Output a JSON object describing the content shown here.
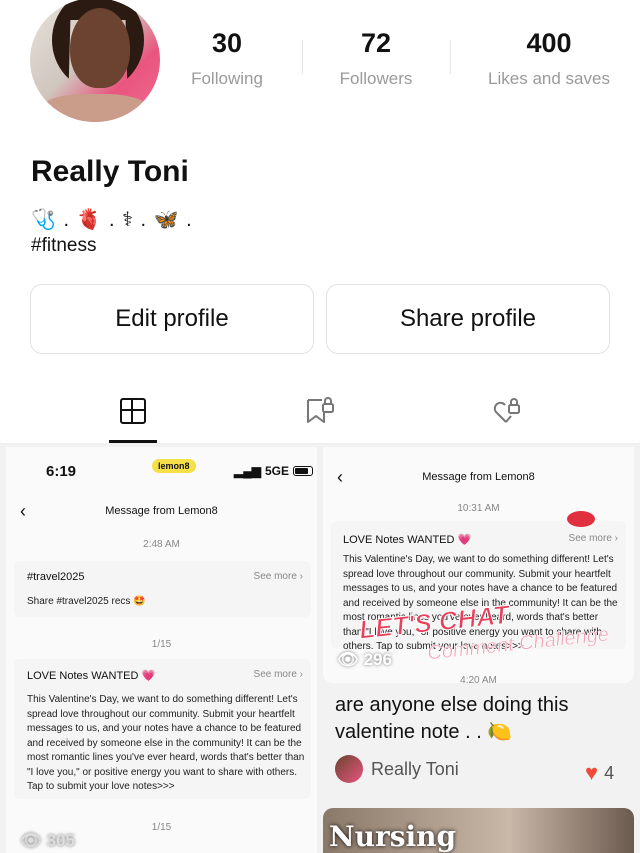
{
  "profile": {
    "name": "Really Toni",
    "bio_emojis": "🩺 . 🫀 . ⚕ . 🦋 .",
    "hashtag": "#fitness",
    "stats": [
      {
        "value": "30",
        "label": "Following"
      },
      {
        "value": "72",
        "label": "Followers"
      },
      {
        "value": "400",
        "label": "Likes and saves"
      }
    ],
    "edit_label": "Edit profile",
    "share_label": "Share profile"
  },
  "tabs": [
    "notes-grid-icon",
    "saved-lock-icon",
    "liked-lock-icon"
  ],
  "post1": {
    "time": "6:19",
    "app_badge": "lemon8",
    "signal": "5GE",
    "header": "Message from Lemon8",
    "ts1": "2:48 AM",
    "item1_title": "#travel2025",
    "item1_more": "See more ›",
    "item1_body": "Share #travel2025 recs 🤩",
    "page1": "1/15",
    "item2_title": "LOVE Notes WANTED 💗",
    "item2_more": "See more ›",
    "item2_body": "This Valentine's Day, we want to do something different! Let's spread love throughout our community. Submit your heartfelt messages to us, and your notes have a chance to be featured and received by someone else in the community! It can be the most romantic lines you've ever heard, words that's better than \"I love you,\" or positive energy you want to share with others. Tap to submit your love notes>>>",
    "page2": "1/15",
    "views": "305"
  },
  "post2": {
    "header": "Message from Lemon8",
    "ts": "10:31 AM",
    "title": "LOVE Notes WANTED 💗",
    "more": "See more ›",
    "body": "This Valentine's Day, we want to do something different! Let's spread love throughout our community. Submit your heartfelt messages to us, and your notes have a chance to be featured and received by someone else in the community! It can be the most romantic lines you've ever heard, words that's better than \"I love you,\" or positive energy you want to share with others. Tap to submit your love notes>>>",
    "overlay1": "LET'S CHAT",
    "overlay2": "Comment Challenge",
    "ts2": "4:20 AM",
    "views": "296",
    "caption": "are anyone else doing this valentine note . . 🍋",
    "author": "Really Toni",
    "likes": "4"
  },
  "post3": {
    "overlay": "Nursing"
  }
}
